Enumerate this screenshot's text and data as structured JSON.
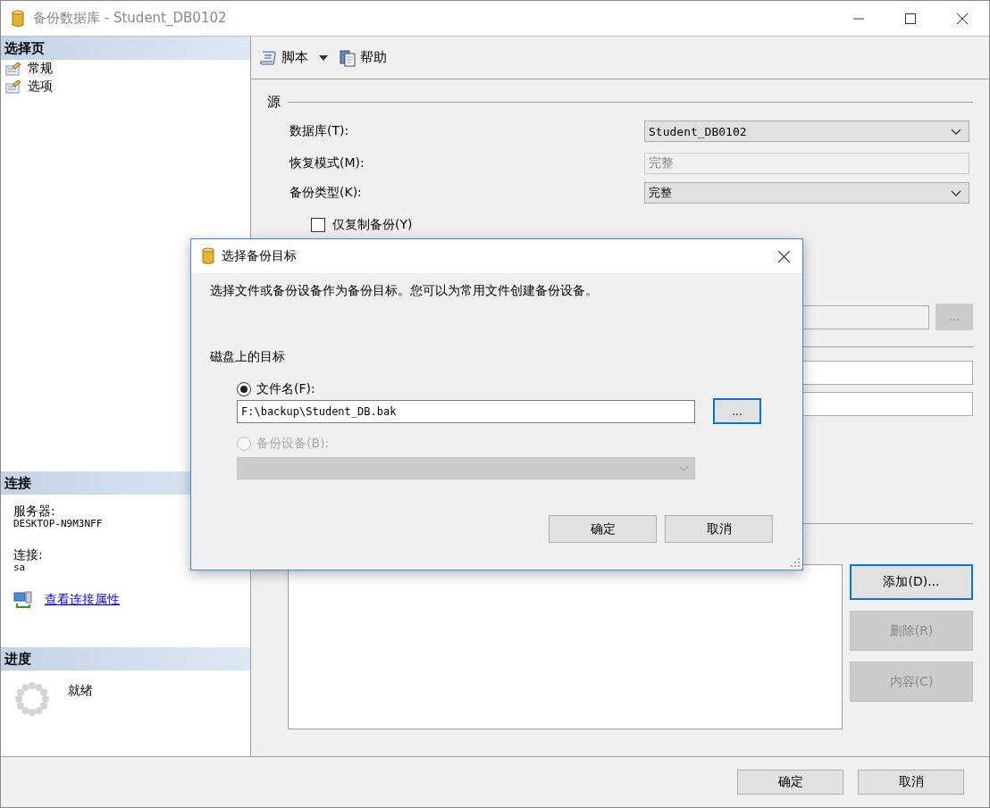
{
  "window": {
    "title": "备份数据库 - Student_DB0102"
  },
  "sidebar": {
    "pages_header": "选择页",
    "pages": [
      {
        "label": "常规",
        "selected": true
      },
      {
        "label": "选项",
        "selected": false
      }
    ],
    "connection": {
      "header": "连接",
      "server_label": "服务器:",
      "server": "DESKTOP-N9M3NFF",
      "login_label": "连接:",
      "login": "sa",
      "link": "查看连接属性"
    },
    "progress": {
      "header": "进度",
      "status": "就绪"
    }
  },
  "toolbar": [
    {
      "label": "脚本",
      "kind": "script",
      "dropdown": true
    },
    {
      "label": "帮助",
      "kind": "help",
      "dropdown": false
    }
  ],
  "source": {
    "legend": "源",
    "fields": [
      {
        "label": "数据库(T):",
        "value": "Student_DB0102",
        "kind": "combo"
      },
      {
        "label": "恢复模式(M):",
        "value": "完整",
        "kind": "readonly"
      },
      {
        "label": "备份类型(K):",
        "value": "完整",
        "kind": "combo"
      }
    ],
    "copy_only": {
      "label": "仅复制备份(Y)",
      "checked": false
    }
  },
  "destination_browse": {
    "label": "...",
    "disabled": true
  },
  "destination_buttons": [
    {
      "label": "添加(D)...",
      "disabled": false,
      "focused": true
    },
    {
      "label": "删除(R)",
      "disabled": true,
      "focused": false
    },
    {
      "label": "内容(C)",
      "disabled": true,
      "focused": false
    }
  ],
  "footer_buttons": [
    "确定",
    "取消"
  ],
  "dialog": {
    "title": "选择备份目标",
    "message": "选择文件或备份设备作为备份目标。您可以为常用文件创建备份设备。",
    "section": "磁盘上的目标",
    "options": [
      {
        "label": "文件名(F):",
        "selected": true,
        "disabled": false
      },
      {
        "label": "备份设备(B):",
        "selected": false,
        "disabled": true
      }
    ],
    "file_name": "F:\\backup\\Student_DB.bak",
    "browse_button": "...",
    "buttons": [
      "确定",
      "取消"
    ]
  }
}
